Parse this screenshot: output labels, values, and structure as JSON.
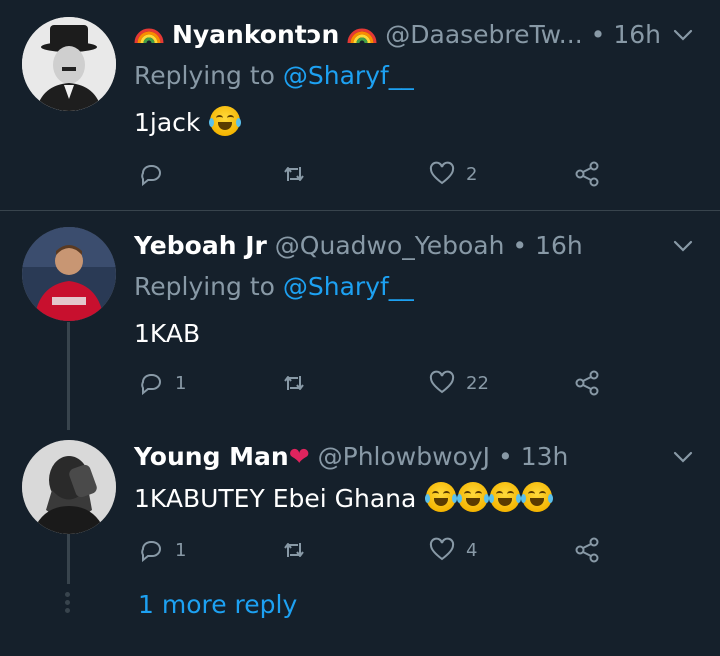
{
  "tweets": [
    {
      "display_name": "Nyankontɔn",
      "handle": "@DaasebreTw...",
      "dot": "•",
      "time": "16h",
      "replying_prefix": "Replying to ",
      "replying_to": "@Sharyf__",
      "text": "1jack",
      "emoji_count": 1,
      "reply_count": "",
      "like_count": "2"
    },
    {
      "display_name": "Yeboah Jr",
      "handle": "@Quadwo_Yeboah",
      "dot": "•",
      "time": "16h",
      "replying_prefix": "Replying to ",
      "replying_to": "@Sharyf__",
      "text": "1KAB",
      "reply_count": "1",
      "like_count": "22"
    },
    {
      "display_name": "Young Man",
      "name_emoji": "❤",
      "handle": "@PhlowbwoyJ",
      "dot": "•",
      "time": "13h",
      "text": "1KABUTEY Ebei Ghana",
      "emoji_count": 4,
      "reply_count": "1",
      "like_count": "4"
    }
  ],
  "more_reply": "1 more reply",
  "colors": {
    "background": "#15202b",
    "secondary_text": "#8899a6",
    "link": "#1da1f2",
    "divider": "#38444d"
  },
  "icons": [
    "reply-icon",
    "retweet-icon",
    "like-icon",
    "share-icon",
    "chevron-down-icon",
    "rainbow-flag-emoji",
    "tears-of-joy-emoji",
    "red-heart-emoji"
  ]
}
